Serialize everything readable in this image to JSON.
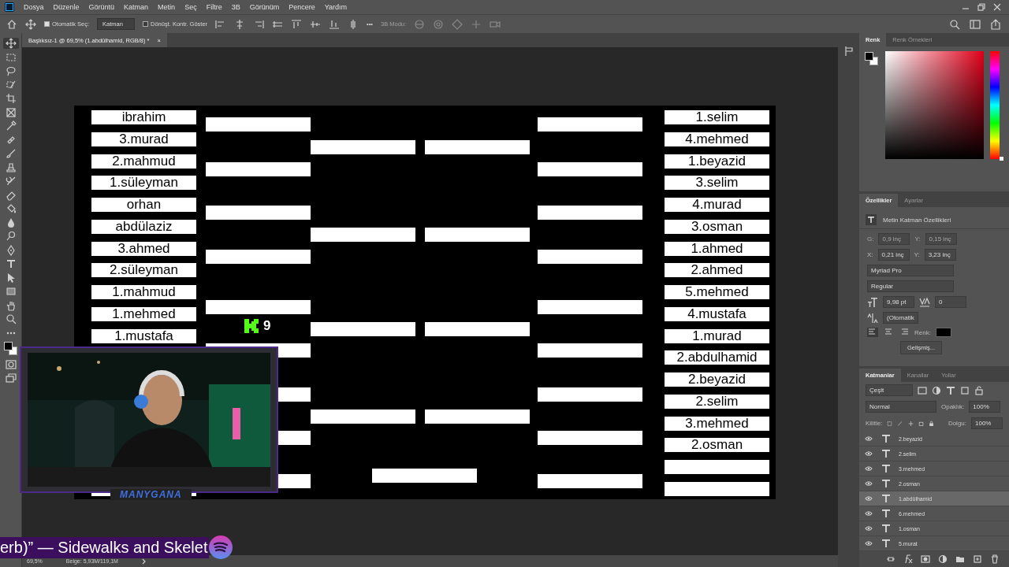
{
  "menu": [
    "Dosya",
    "Düzenle",
    "Görüntü",
    "Katman",
    "Metin",
    "Seç",
    "Filtre",
    "3B",
    "Görünüm",
    "Pencere",
    "Yardım"
  ],
  "options_bar": {
    "auto_select": {
      "label": "Otomatik Seç:",
      "checked": true
    },
    "target": "Katman",
    "transform_controls": {
      "label": "Dönüşt. Kontr. Göster",
      "checked": false
    },
    "more": "•••",
    "mode_3d": {
      "label": "3B Modu:",
      "disabled": true
    }
  },
  "tools": [
    {
      "kind": "move",
      "selected": true
    },
    {
      "kind": "marquee",
      "selected": false
    },
    {
      "kind": "lasso",
      "selected": false
    },
    {
      "kind": "quick_select",
      "selected": false
    },
    {
      "kind": "crop",
      "selected": false
    },
    {
      "kind": "frame",
      "selected": false
    },
    {
      "kind": "eyedropper",
      "selected": false
    },
    {
      "kind": "healing",
      "selected": false
    },
    {
      "kind": "brush",
      "selected": false
    },
    {
      "kind": "stamp",
      "selected": false
    },
    {
      "kind": "history",
      "selected": false
    },
    {
      "kind": "eraser",
      "selected": false
    },
    {
      "kind": "bucket",
      "selected": false
    },
    {
      "kind": "blur",
      "selected": false
    },
    {
      "kind": "dodge",
      "selected": false
    },
    {
      "kind": "pen",
      "selected": false
    },
    {
      "kind": "type",
      "selected": false
    },
    {
      "kind": "path_select",
      "selected": false
    },
    {
      "kind": "shape",
      "selected": false
    },
    {
      "kind": "hand",
      "selected": false
    },
    {
      "kind": "zoom",
      "selected": false
    },
    {
      "kind": "more",
      "selected": false
    }
  ],
  "doc_tab": {
    "title": "Başlıksız-1 @ 69,5% (1.abdülhamid, RGB/8) *",
    "close": "×"
  },
  "bracket": {
    "left_names": [
      "ibrahim",
      "3.murad",
      "2.mahmud",
      "1.süleyman",
      "orhan",
      "abdülaziz",
      "3.ahmed",
      "2.süleyman",
      "1.mahmud",
      "1.mehmed",
      "1.mustafa"
    ],
    "right_names": [
      "1.selim",
      "4.mehmed",
      "1.beyazid",
      "3.selim",
      "4.murad",
      "3.osman",
      "1.ahmed",
      "2.ahmed",
      "5.mehmed",
      "4.mustafa",
      "1.murad",
      "2.abdulhamid",
      "2.beyazid",
      "2.selim",
      "3.mehmed",
      "2.osman"
    ]
  },
  "stream_badge": {
    "count": "9"
  },
  "webcam": {
    "caption": "MANYGANA"
  },
  "now_playing": {
    "text": "erb)” — Sidewalks and Skelet"
  },
  "status_bar": {
    "zoom": "69,5%",
    "doc_info": "Belge: 5,93M/119,1M"
  },
  "color_panel": {
    "tabs": [
      {
        "label": "Renk",
        "selected": true
      },
      {
        "label": "Renk Örnekleri",
        "selected": false
      }
    ],
    "hue": {
      "level": 0
    }
  },
  "properties_panel": {
    "tabs": [
      {
        "label": "Özellikler",
        "selected": true
      },
      {
        "label": "Ayarlar",
        "selected": false
      }
    ],
    "title": "Metin Katman Özellikleri",
    "size_fields": [
      {
        "label": "G:",
        "value": "0,9 inç",
        "disabled": true
      },
      {
        "label": "Y:",
        "value": "0,15 inç",
        "disabled": true
      }
    ],
    "position_fields": [
      {
        "label": "X:",
        "value": "0,21 inç",
        "disabled": false
      },
      {
        "label": "Y:",
        "value": "3,23 inç",
        "disabled": false
      }
    ],
    "font_family": "Myriad Pro",
    "font_style": "Regular",
    "font_size": "9,98 pt",
    "tracking": "0",
    "leading": "(Otomatik",
    "align": [
      {
        "selected": true
      },
      {
        "selected": false
      },
      {
        "selected": false
      }
    ],
    "color_label": "Renk:",
    "color": "#000000",
    "advanced_button": "Gelişmiş..."
  },
  "layers_panel": {
    "tabs": [
      {
        "label": "Katmanlar",
        "selected": true
      },
      {
        "label": "Kanallar",
        "selected": false
      },
      {
        "label": "Yollar",
        "selected": false
      }
    ],
    "filter": "Çeşit",
    "blend_mode": "Normal",
    "opacity_label": "Opaklık:",
    "opacity": "100%",
    "lock_label": "Kilitle:",
    "fill_label": "Dolgu:",
    "fill": "100%",
    "items": [
      {
        "name": "2.beyazid",
        "visible": true,
        "selected": false
      },
      {
        "name": "2.selim",
        "visible": true,
        "selected": false
      },
      {
        "name": "3.mehmed",
        "visible": true,
        "selected": false
      },
      {
        "name": "2.osman",
        "visible": true,
        "selected": false
      },
      {
        "name": "1.abdülhamid",
        "visible": true,
        "selected": true
      },
      {
        "name": "6.mehmed",
        "visible": true,
        "selected": false
      },
      {
        "name": "1.osman",
        "visible": true,
        "selected": false
      },
      {
        "name": "5.murat",
        "visible": true,
        "selected": false
      }
    ]
  }
}
